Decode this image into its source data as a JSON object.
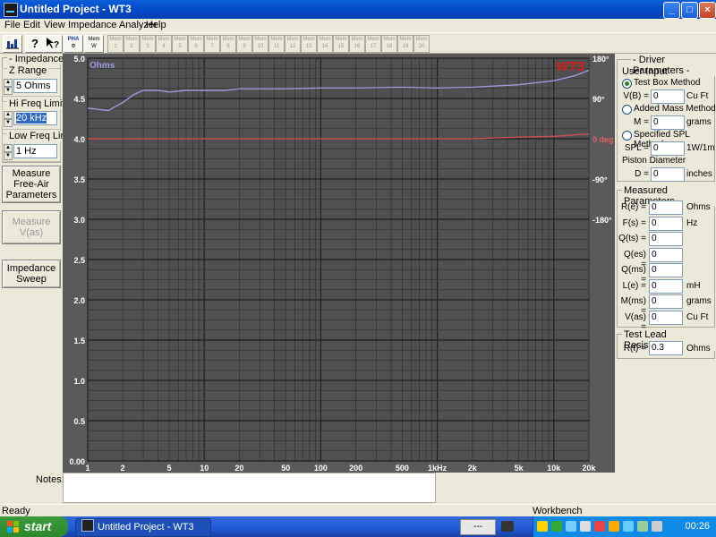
{
  "window": {
    "title": "Untitled Project - WT3",
    "min": "_",
    "max": "□",
    "close": "×"
  },
  "menu": [
    "File",
    "Edit",
    "View",
    "Impedance Analyzer",
    "Help"
  ],
  "toolbar": {
    "pha_label": "PHA",
    "mem_label": "Mem",
    "mem_w": "W",
    "mem_slots": [
      "1",
      "2",
      "3",
      "4",
      "5",
      "6",
      "7",
      "8",
      "9",
      "10",
      "11",
      "12",
      "13",
      "14",
      "15",
      "16",
      "17",
      "18",
      "19",
      "20"
    ]
  },
  "left": {
    "group_title": "- Impedance -",
    "z_range_label": "Z Range",
    "z_range_value": "5 Ohms",
    "hi_freq_label": "Hi Freq Limit",
    "hi_freq_value": "20 kHz",
    "low_freq_label": "Low Freq Limit",
    "low_freq_value": "1 Hz",
    "measure_free_air": [
      "Measure",
      "Free-Air",
      "Parameters"
    ],
    "measure_vas": "Measure V(as)",
    "impedance_sweep": [
      "Impedance",
      "Sweep"
    ]
  },
  "chart_data": {
    "type": "line",
    "logo": "WT3",
    "ylabel_left": "Ohms",
    "y_left_ticks": [
      "5.0",
      "4.5",
      "4.0",
      "3.5",
      "3.0",
      "2.5",
      "2.0",
      "1.5",
      "1.0",
      "0.5",
      "0.00"
    ],
    "y_right_ticks": [
      "180°",
      "90°",
      "0 deg",
      "-90°",
      "-180°"
    ],
    "x_ticks": [
      "1",
      "2",
      "5",
      "10",
      "20",
      "50",
      "100",
      "200",
      "500",
      "1kHz",
      "2k",
      "5k",
      "10k",
      "20k"
    ],
    "x_log": true,
    "xlim": [
      1,
      20000
    ],
    "ylim": [
      0,
      5
    ],
    "series": [
      {
        "color": "#9a9cd9",
        "x": [
          1,
          1.5,
          2,
          2.5,
          3,
          4,
          5,
          7,
          10,
          15,
          20,
          30,
          50,
          100,
          200,
          500,
          1000,
          2000,
          5000,
          10000,
          15000,
          20000
        ],
        "y": [
          4.38,
          4.35,
          4.45,
          4.55,
          4.6,
          4.6,
          4.58,
          4.6,
          4.6,
          4.6,
          4.62,
          4.62,
          4.62,
          4.63,
          4.63,
          4.64,
          4.63,
          4.64,
          4.67,
          4.72,
          4.78,
          4.85
        ]
      },
      {
        "color": "#c85050",
        "x": [
          1,
          10,
          100,
          1000,
          2000,
          5000,
          10000,
          20000
        ],
        "y": [
          4.0,
          4.0,
          4.0,
          4.0,
          4.0,
          4.02,
          4.03,
          4.06
        ]
      }
    ]
  },
  "driver": {
    "title": "- Driver Parameters -",
    "user_input": "User Input",
    "methods": [
      "Test Box Method",
      "Added Mass Method",
      "Specified SPL Method"
    ],
    "vb_label": "V(B) =",
    "vb_value": "0",
    "vb_unit": "Cu Ft",
    "m_label": "M =",
    "m_value": "0",
    "m_unit": "grams",
    "spl_label": "SPL =",
    "spl_value": "0",
    "spl_unit": "1W/1m",
    "piston": "Piston Diameter",
    "d_label": "D =",
    "d_value": "0",
    "d_unit": "inches"
  },
  "measured": {
    "title": "Measured Parameters",
    "rows": [
      {
        "label": "R(e) =",
        "value": "0",
        "unit": "Ohms"
      },
      {
        "label": "F(s) =",
        "value": "0",
        "unit": "Hz"
      },
      {
        "label": "Q(ts) =",
        "value": "0",
        "unit": ""
      },
      {
        "label": "Q(es) =",
        "value": "0",
        "unit": ""
      },
      {
        "label": "Q(ms) =",
        "value": "0",
        "unit": ""
      },
      {
        "label": "L(e) =",
        "value": "0",
        "unit": "mH"
      },
      {
        "label": "M(ms) =",
        "value": "0",
        "unit": "grams"
      },
      {
        "label": "V(as) =",
        "value": "0",
        "unit": "Cu Ft"
      }
    ]
  },
  "lead": {
    "title": "Test Lead Resistance",
    "label": "R(t) =",
    "value": "0.3",
    "unit": "Ohms"
  },
  "notes_label": "Notes:",
  "status": {
    "left": "Ready",
    "right": "Workbench"
  },
  "taskbar": {
    "start": "start",
    "task": "Untitled Project - WT3",
    "lang": "---",
    "clock": "00:26"
  }
}
